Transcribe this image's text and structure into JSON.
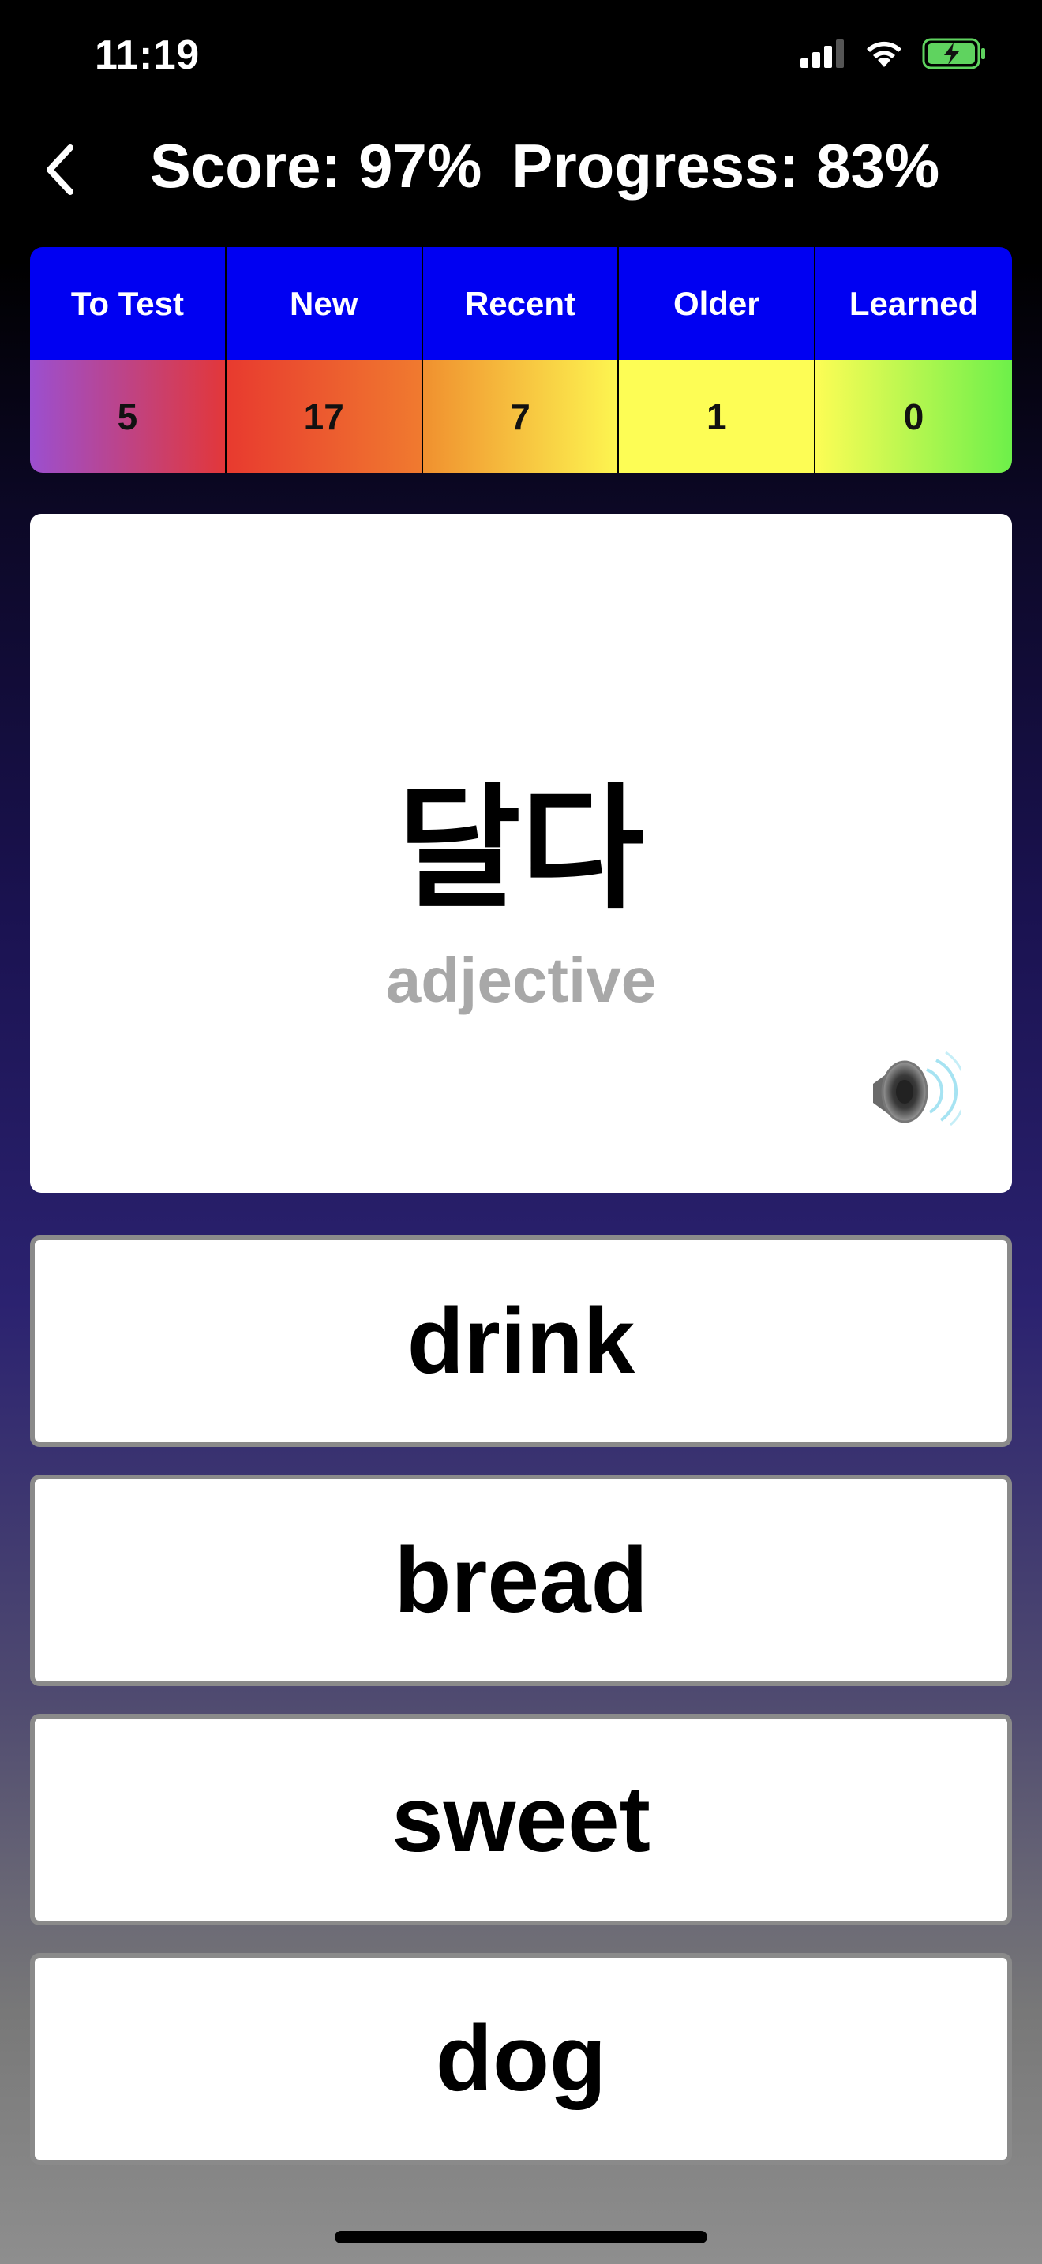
{
  "status_bar": {
    "time": "11:19"
  },
  "header": {
    "score": "Score: 97%",
    "progress": "Progress: 83%"
  },
  "stats": {
    "headers": [
      "To Test",
      "New",
      "Recent",
      "Older",
      "Learned"
    ],
    "values": [
      "5",
      "17",
      "7",
      "1",
      "0"
    ]
  },
  "card": {
    "word": "달다",
    "part_of_speech": "adjective"
  },
  "answers": [
    "drink",
    "bread",
    "sweet",
    "dog"
  ],
  "colors": {
    "header_blue": "#0000f2",
    "card_bg": "#ffffff",
    "pos_gray": "#a8a8a8"
  },
  "icons": {
    "back": "chevron-left-icon",
    "speaker": "speaker-icon",
    "signal": "cellular-signal-icon",
    "wifi": "wifi-icon",
    "battery": "battery-charging-icon"
  }
}
